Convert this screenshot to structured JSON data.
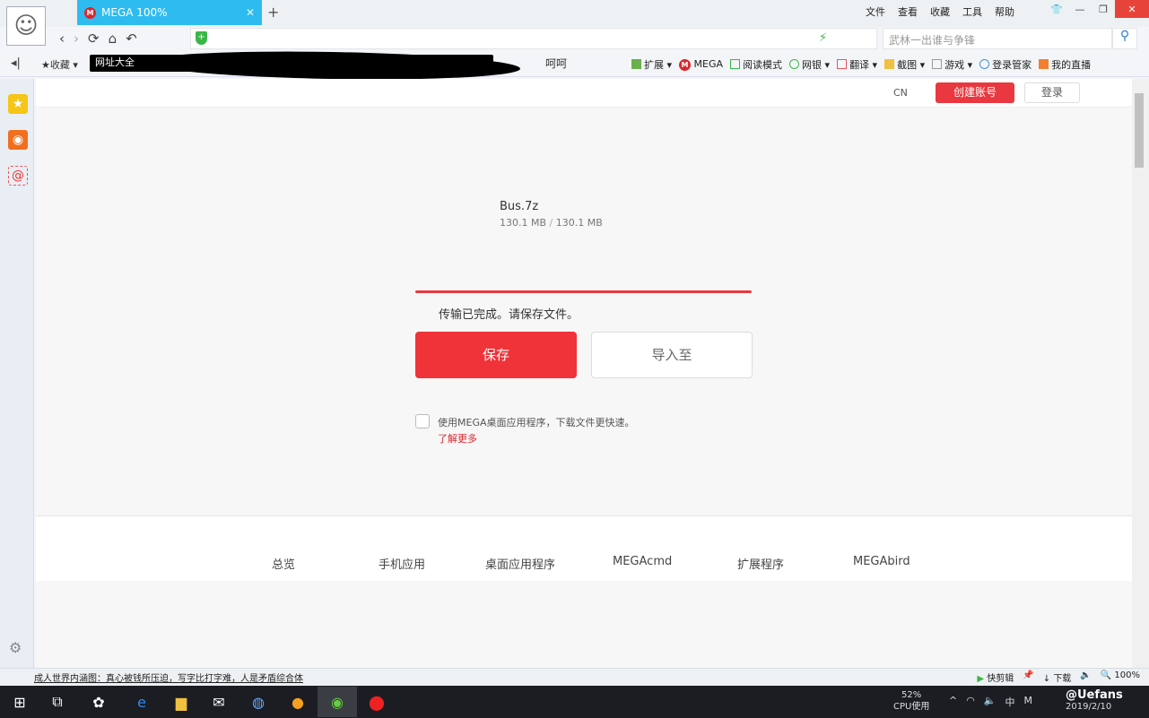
{
  "browser": {
    "tab_title": "MEGA 100%",
    "search_placeholder": "武林一出谁与争锋",
    "menu": [
      "文件",
      "查看",
      "收藏",
      "工具",
      "帮助"
    ],
    "bookmarks_label": "收藏",
    "bookmark_first": "网址大全",
    "bookmark_hehe": "呵呵",
    "toolbar": [
      "扩展",
      "MEGA",
      "阅读模式",
      "网银",
      "翻译",
      "截图",
      "游戏",
      "登录管家",
      "我的直播"
    ]
  },
  "page": {
    "lang": "CN",
    "create_account": "创建账号",
    "login": "登录",
    "file_name": "Bus.7z",
    "downloaded": "130.1 MB",
    "separator": "/",
    "total": "130.1 MB",
    "progress_percent": 100,
    "status": "传输已完成。请保存文件。",
    "save": "保存",
    "import": "导入至",
    "checkbox_label": "使用MEGA桌面应用程序，下载文件更快速。",
    "learn_more": "了解更多",
    "footer_links": [
      "总览",
      "手机应用",
      "桌面应用程序",
      "MEGAcmd",
      "扩展程序",
      "MEGAbird"
    ]
  },
  "statusbar": {
    "news": "成人世界内涵图：真心被钱所压迫，写字比打字难，人是矛盾综合体",
    "quick_cut": "快剪辑",
    "download": "下载",
    "zoom": "100%"
  },
  "taskbar": {
    "cpu_percent": "52%",
    "cpu_label": "CPU使用",
    "ime": "中",
    "date": "2019/2/10",
    "watermark": "@Uefans"
  },
  "colors": {
    "accent": "#ef3339",
    "tab": "#2ebcf0"
  }
}
